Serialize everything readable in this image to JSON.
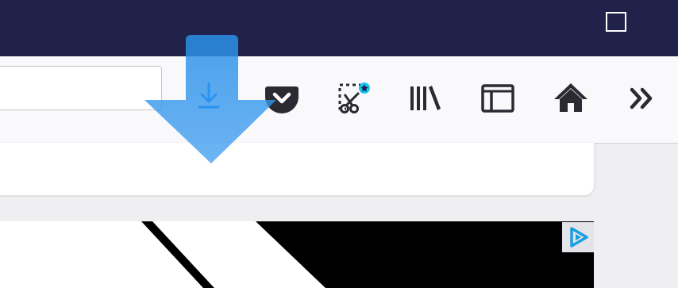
{
  "window": {
    "maximize_label": "Maximize"
  },
  "toolbar": {
    "url_value": "",
    "buttons": [
      {
        "name": "downloads",
        "icon": "download-icon"
      },
      {
        "name": "pocket",
        "icon": "pocket-icon"
      },
      {
        "name": "screenshot",
        "icon": "screenshot-icon"
      },
      {
        "name": "library",
        "icon": "library-icon"
      },
      {
        "name": "sidebar",
        "icon": "sidebar-icon"
      },
      {
        "name": "home",
        "icon": "home-icon"
      },
      {
        "name": "overflow",
        "icon": "chevron-double-right-icon"
      }
    ]
  },
  "overlay": {
    "icon": "download-arrow-animation-icon",
    "color": "#2a90e8"
  },
  "ad": {
    "icon": "adchoices-icon",
    "accent": "#1a9ee0"
  },
  "colors": {
    "titlebar": "#20224a",
    "toolbar": "#f9f9fb",
    "icon": "#2b2a33",
    "download_accent": "#0a84ff"
  }
}
